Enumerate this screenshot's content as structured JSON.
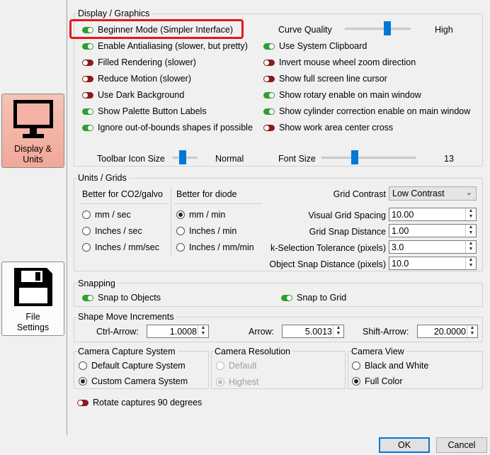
{
  "nav": {
    "display_units": "Display &\nUnits",
    "file_settings": "File\nSettings"
  },
  "display": {
    "title": "Display / Graphics",
    "left_options": [
      {
        "label": "Beginner Mode (Simpler Interface)",
        "on": true
      },
      {
        "label": "Enable Antialiasing (slower, but pretty)",
        "on": true
      },
      {
        "label": "Filled Rendering (slower)",
        "on": false
      },
      {
        "label": "Reduce Motion (slower)",
        "on": false
      },
      {
        "label": "Use Dark Background",
        "on": false
      },
      {
        "label": "Show Palette Button Labels",
        "on": true
      },
      {
        "label": "Ignore out-of-bounds shapes if possible",
        "on": true
      }
    ],
    "curve_quality_label": "Curve Quality",
    "curve_quality_value": "High",
    "curve_quality_level": 0.75,
    "right_options": [
      {
        "label": "Use System Clipboard",
        "on": true
      },
      {
        "label": "Invert mouse wheel zoom direction",
        "on": false
      },
      {
        "label": "Show full screen line cursor",
        "on": false
      },
      {
        "label": "Show rotary enable on main window",
        "on": true
      },
      {
        "label": "Show cylinder correction enable on main window",
        "on": true
      },
      {
        "label": "Show work area center cross",
        "on": false
      }
    ],
    "toolbar_icon_size_label": "Toolbar Icon Size",
    "toolbar_icon_size_value": "Normal",
    "font_size_label": "Font Size",
    "font_size_value": "13"
  },
  "units": {
    "title": "Units / Grids",
    "co2_header": "Better for CO2/galvo",
    "co2_options": [
      {
        "label": "mm / sec",
        "selected": false
      },
      {
        "label": "Inches / sec",
        "selected": false
      },
      {
        "label": "Inches / mm/sec",
        "selected": false
      }
    ],
    "diode_header": "Better for diode",
    "diode_options": [
      {
        "label": "mm / min",
        "selected": true
      },
      {
        "label": "Inches / min",
        "selected": false
      },
      {
        "label": "Inches / mm/min",
        "selected": false
      }
    ],
    "grid_contrast_label": "Grid Contrast",
    "grid_contrast_value": "Low Contrast",
    "visual_grid_spacing_label": "Visual Grid Spacing",
    "visual_grid_spacing_value": "10.00",
    "grid_snap_distance_label": "Grid Snap Distance",
    "grid_snap_distance_value": "1.00",
    "selection_tolerance_label": "k-Selection Tolerance (pixels)",
    "selection_tolerance_value": "3.0",
    "object_snap_distance_label": "Object Snap Distance (pixels)",
    "object_snap_distance_value": "10.0"
  },
  "snapping": {
    "title": "Snapping",
    "snap_objects": "Snap to Objects",
    "snap_grid": "Snap to Grid"
  },
  "shape_move": {
    "title": "Shape Move Increments",
    "ctrl_arrow_label": "Ctrl-Arrow:",
    "ctrl_arrow_value": "1.0008",
    "arrow_label": "Arrow:",
    "arrow_value": "5.0013",
    "shift_arrow_label": "Shift-Arrow:",
    "shift_arrow_value": "20.0000"
  },
  "camera_capture": {
    "title": "Camera Capture System",
    "options": [
      {
        "label": "Default Capture System",
        "selected": false
      },
      {
        "label": "Custom Camera System",
        "selected": true
      }
    ]
  },
  "camera_resolution": {
    "title": "Camera Resolution",
    "options": [
      {
        "label": "Default",
        "selected": false
      },
      {
        "label": "Highest",
        "selected": true
      }
    ]
  },
  "camera_view": {
    "title": "Camera View",
    "options": [
      {
        "label": "Black and White",
        "selected": false
      },
      {
        "label": "Full Color",
        "selected": true
      }
    ]
  },
  "rotate_captures": "Rotate captures 90 degrees",
  "buttons": {
    "ok": "OK",
    "cancel": "Cancel"
  }
}
